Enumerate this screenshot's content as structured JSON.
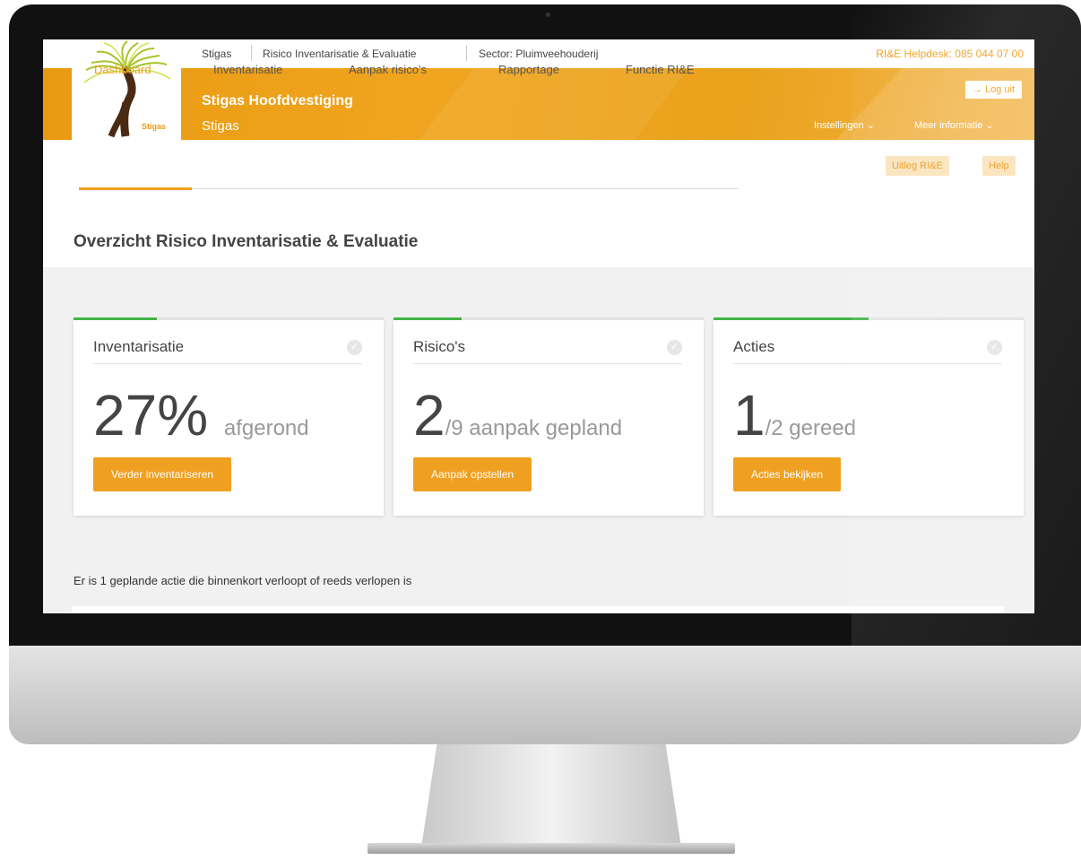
{
  "topbar": {
    "org": "Stigas",
    "app": "Risico Inventarisatie & Evaluatie",
    "sector": "Sector: Pluimveehouderij",
    "helpdesk": "RI&E Helpdesk: 085 044 07 00"
  },
  "logo": {
    "text": "Stigas"
  },
  "header": {
    "company": "Stigas Hoofdvestiging",
    "subcompany": "Stigas",
    "logout": "→ Log uit",
    "settings": "Instellingen ⌄",
    "more": "Meer informatie ⌄"
  },
  "tabs": [
    "Dashboard",
    "Inventarisatie",
    "Aanpak risico's",
    "Rapportage",
    "Functie RI&E"
  ],
  "help": {
    "uitleg": "Uitleg RI&E",
    "help": "Help"
  },
  "page_title": "Overzicht Risico Inventarisatie & Evaluatie",
  "cards": [
    {
      "title": "Inventarisatie",
      "big": "27%",
      "suffix": "afgerond",
      "button": "Verder inventariseren",
      "progress": 0.27
    },
    {
      "title": "Risico's",
      "big": "2",
      "suffix": "/9 aanpak gepland",
      "button": "Aanpak opstellen",
      "progress": 0.22
    },
    {
      "title": "Acties",
      "big": "1",
      "suffix": "/2 gereed",
      "button": "Acties bekijken",
      "progress": 0.5
    }
  ],
  "notice": "Er is 1 geplande actie die binnenkort verloopt of reeds verlopen is",
  "colors": {
    "accent": "#f0a020",
    "progress": "#44b549"
  }
}
